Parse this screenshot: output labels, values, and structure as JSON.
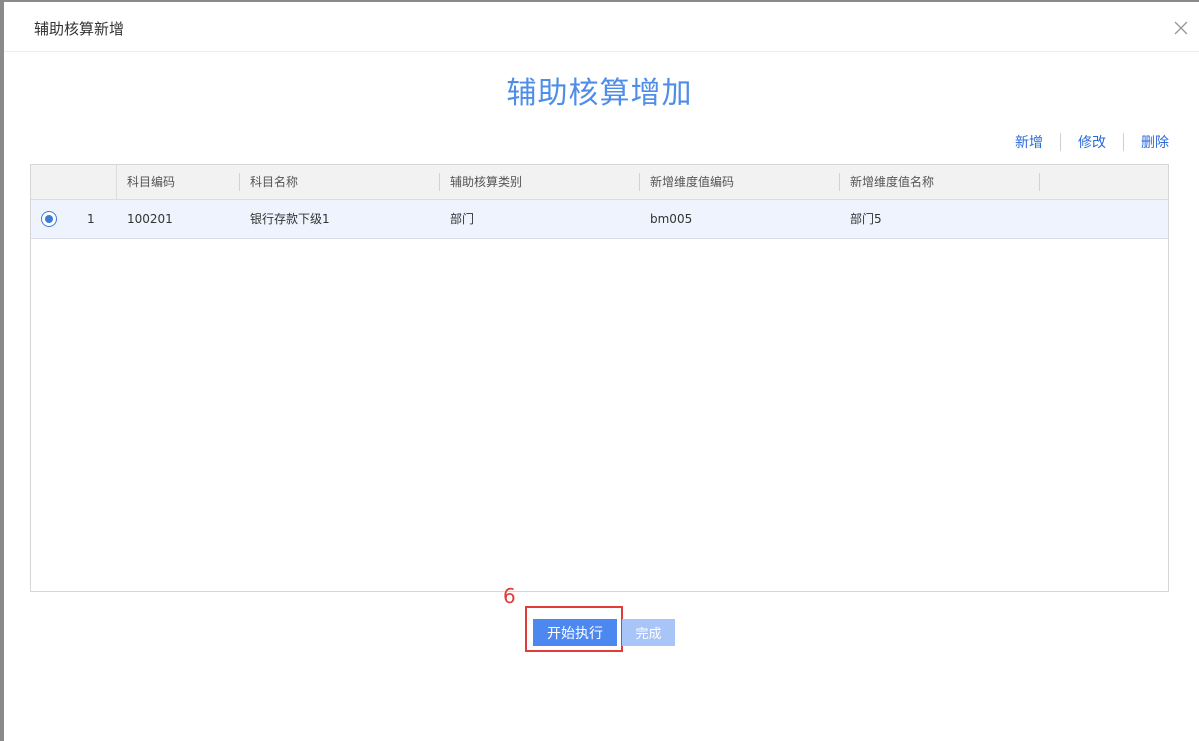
{
  "dialog": {
    "title": "辅助核算新增",
    "heading": "辅助核算增加",
    "close_icon": "close-icon"
  },
  "actions": {
    "add": "新增",
    "edit": "修改",
    "delete": "删除"
  },
  "table": {
    "columns": [
      "科目编码",
      "科目名称",
      "辅助核算类别",
      "新增维度值编码",
      "新增维度值名称"
    ],
    "rows": [
      {
        "index": "1",
        "selected": true,
        "cells": [
          "100201",
          "银行存款下级1",
          "部门",
          "bm005",
          "部门5"
        ]
      }
    ]
  },
  "annotation": {
    "step_number": "6"
  },
  "footer": {
    "start_label": "开始执行",
    "done_label": "完成"
  },
  "colors": {
    "accent": "#4f8ee8",
    "primary_button": "#4d88f0",
    "disabled_button": "#a9c4f7",
    "annotation_red": "#e23b3b",
    "selected_row": "#eef3fd"
  }
}
